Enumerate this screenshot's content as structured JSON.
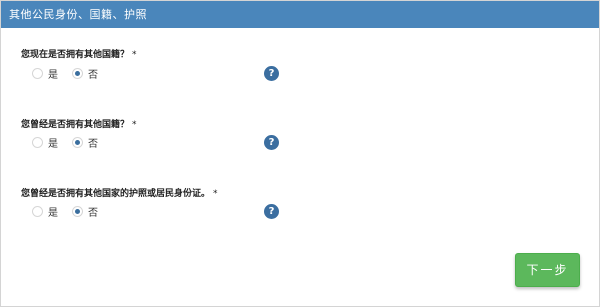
{
  "header": {
    "title": "其他公民身份、国籍、护照"
  },
  "questions": [
    {
      "label": "您现在是否拥有其他国籍？",
      "required_mark": "*",
      "options": [
        {
          "label": "是",
          "checked": false
        },
        {
          "label": "否",
          "checked": true
        }
      ],
      "help_label": "?"
    },
    {
      "label": "您曾经是否拥有其他国籍？",
      "required_mark": "*",
      "options": [
        {
          "label": "是",
          "checked": false
        },
        {
          "label": "否",
          "checked": true
        }
      ],
      "help_label": "?"
    },
    {
      "label": "您曾经是否拥有其他国家的护照或居民身份证。",
      "required_mark": "*",
      "options": [
        {
          "label": "是",
          "checked": false
        },
        {
          "label": "否",
          "checked": true
        }
      ],
      "help_label": "?"
    }
  ],
  "footer": {
    "next_label": "下一步"
  },
  "colors": {
    "header": "#4a86bb",
    "next_button": "#5cb85c",
    "help_icon": "#3b6ea0"
  }
}
